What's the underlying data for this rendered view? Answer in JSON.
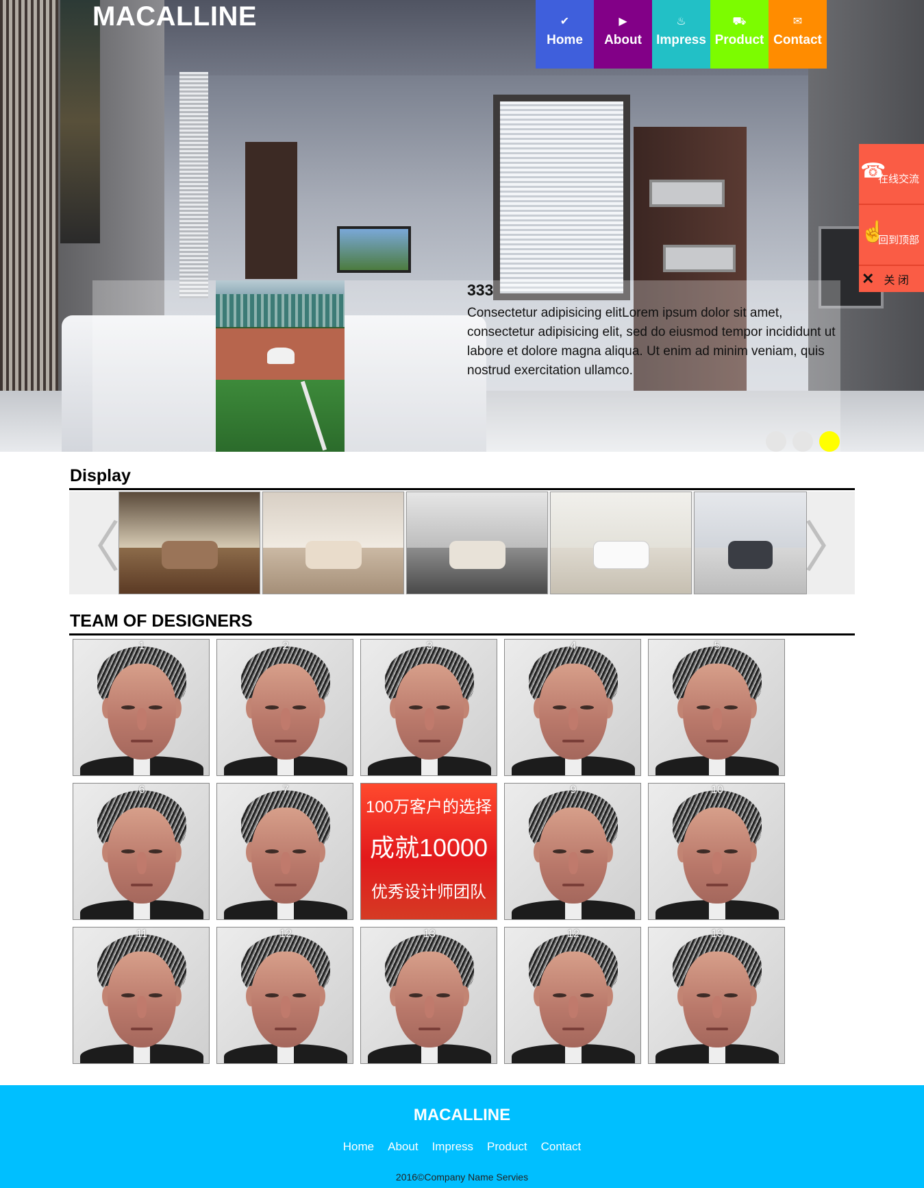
{
  "header": {
    "brand": "MACALLINE",
    "nav": [
      {
        "label": "Home",
        "icon": "check-icon",
        "glyph": "✔",
        "color": "#3f5fdc"
      },
      {
        "label": "About",
        "icon": "play-icon",
        "glyph": "▶",
        "color": "#820087"
      },
      {
        "label": "Impress",
        "icon": "gallery-icon",
        "glyph": "♨",
        "color": "#22c0c6"
      },
      {
        "label": "Product",
        "icon": "truck-icon",
        "glyph": "⛟",
        "color": "#7cfc00"
      },
      {
        "label": "Contact",
        "icon": "mail-icon",
        "glyph": "✉",
        "color": "#ff8c00"
      }
    ]
  },
  "slider": {
    "title": "333",
    "text": "Consectetur adipisicing elitLorem ipsum dolor sit amet, consectetur adipisicing elit, sed do eiusmod tempor incididunt ut labore et dolore magna aliqua. Ut enim ad minim veniam, quis nostrud exercitation ullamco.",
    "dots": 3,
    "active_dot": 3,
    "active_color": "#ffff00"
  },
  "float_panel": {
    "chat_label": "在线交流",
    "top_label": "回到顶部",
    "close_label": "关 闭",
    "color": "#fa5c45"
  },
  "display": {
    "title": "Display",
    "prev_glyph": "〈",
    "next_glyph": "〉"
  },
  "team": {
    "title": "TEAM OF DESIGNERS",
    "cards": [
      "1",
      "2",
      "3",
      "4",
      "5",
      "6",
      "7",
      "PROMO",
      "9",
      "10",
      "11",
      "12",
      "13",
      "12",
      "13"
    ],
    "promo": {
      "line1": "100万客户的选择",
      "line2": "成就10000",
      "line3": "优秀设计师团队"
    }
  },
  "footer": {
    "brand": "MACALLINE",
    "links": [
      "Home",
      "About",
      "Impress",
      "Product",
      "Contact"
    ],
    "copyright": "2016©Company Name Servies",
    "color": "#00bfff"
  }
}
